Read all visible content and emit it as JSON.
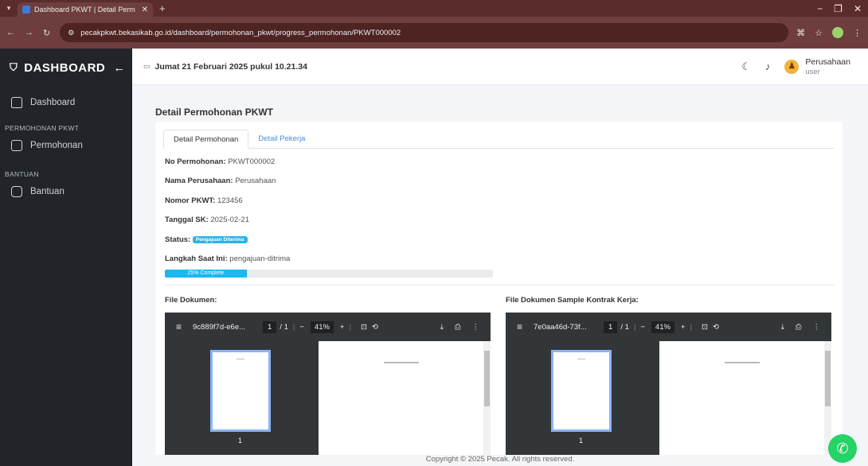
{
  "browser": {
    "tab_title": "Dashboard PKWT | Detail Perm",
    "url": "pecakpkwt.bekasikab.go.id/dashboard/permohonan_pkwt/progress_permohonan/PKWT000002"
  },
  "sidebar": {
    "brand": "DASHBOARD",
    "items": [
      {
        "label": "Dashboard"
      },
      {
        "section": "PERMOHONAN PKWT"
      },
      {
        "label": "Permohonan"
      },
      {
        "section": "BANTUAN"
      },
      {
        "label": "Bantuan"
      }
    ]
  },
  "topbar": {
    "datetime": "Jumat  21 Februari 2025 pukul 10.21.34",
    "user_name": "Perusahaan",
    "user_role": "user"
  },
  "page": {
    "title": "Detail Permohonan PKWT",
    "tabs": [
      "Detail Permohonan",
      "Detail Pekerja"
    ],
    "fields": [
      {
        "label": "No Permohonan:",
        "value": "PKWT000002"
      },
      {
        "label": "Nama Perusahaan:",
        "value": "Perusahaan"
      },
      {
        "label": "Nomor PKWT:",
        "value": "123456"
      },
      {
        "label": "Tanggal SK:",
        "value": "2025-02-21"
      },
      {
        "label": "Status:",
        "value": "Pengajuan Diterima"
      },
      {
        "label": "Langkah Saat Ini:",
        "value": "pengajuan-ditrima"
      }
    ],
    "progress": {
      "percent": 25,
      "label": "25% Complete"
    },
    "doc_left_label": "File Dokumen:",
    "doc_right_label": "File Dokumen Sample Kontrak Kerja:"
  },
  "viewers": [
    {
      "filename": "9c889f7d-e6e...",
      "page": "1",
      "pages": "/ 1",
      "zoom": "41%",
      "thumb_num": "1"
    },
    {
      "filename": "7e0aa46d-73f...",
      "page": "1",
      "pages": "/ 1",
      "zoom": "41%",
      "thumb_num": "1"
    }
  ],
  "footer": "Copyright © 2025 Pecak. All rights reserved."
}
